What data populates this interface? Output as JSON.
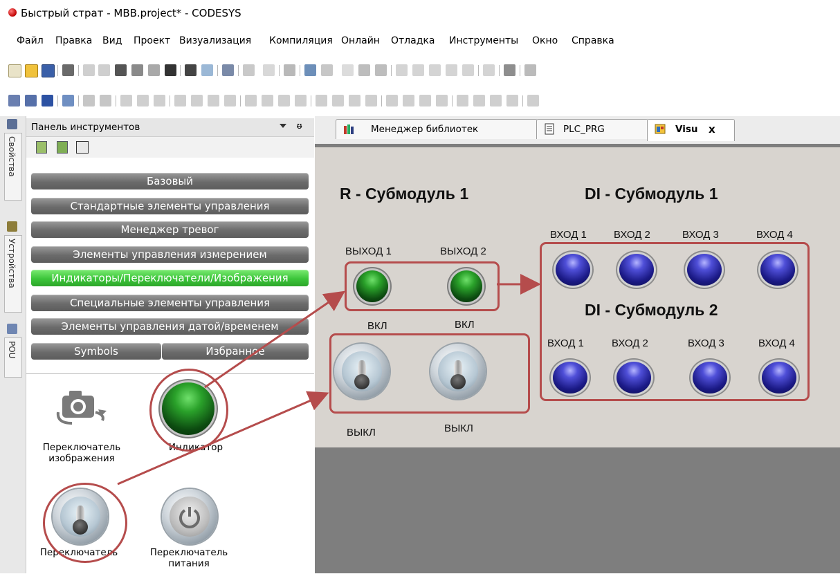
{
  "window": {
    "title": "Быстрый страт - MBB.project* - CODESYS"
  },
  "menu": {
    "items": [
      "Файл",
      "Правка",
      "Вид",
      "Проект",
      "Визуализация",
      "Компиляция",
      "Онлайн",
      "Отладка",
      "Инструменты",
      "Окно",
      "Справка"
    ]
  },
  "side_tabs": {
    "properties": "Свойства",
    "devices": "Устройства",
    "pou": "POU"
  },
  "toolbox": {
    "title": "Панель инструментов",
    "categories": [
      "Базовый",
      "Стандартные элементы управления",
      "Менеджер тревог",
      "Элементы управления измерением",
      "Индикаторы/Переключатели/Изображения",
      "Специальные элементы управления",
      "Элементы управления датой/временем"
    ],
    "bottom_tabs": [
      "Symbols",
      "Избранное"
    ],
    "items": {
      "image_switcher": "Переключатель изображения",
      "lamp": "Индикатор",
      "switch": "Переключатель",
      "power_switch": "Переключатель питания"
    }
  },
  "tabs": [
    {
      "label": "Менеджер библиотек",
      "active": false
    },
    {
      "label": "PLC_PRG",
      "active": false
    },
    {
      "label": "Visu",
      "active": true,
      "close": "x"
    }
  ],
  "visu": {
    "r_title": "R - Субмодуль 1",
    "di1_title": "DI - Субмодуль 1",
    "di2_title": "DI - Субмодуль 2",
    "outputs": [
      "ВЫХОД 1",
      "ВЫХОД 2"
    ],
    "on_labels": [
      "ВКЛ",
      "ВКЛ"
    ],
    "off_labels": [
      "ВЫКЛ",
      "ВЫКЛ"
    ],
    "di1_inputs": [
      "ВХОД 1",
      "ВХОД 2",
      "ВХОД 3",
      "ВХОД 4"
    ],
    "di2_inputs": [
      "ВХОД 1",
      "ВХОД 2",
      "ВХОД 3",
      "ВХОД 4"
    ]
  },
  "colors": {
    "annotation": "#b54c4c",
    "lamp_green": "#2aa12a",
    "lamp_blue": "#1b1a86",
    "active_category": "#3cc53a"
  }
}
